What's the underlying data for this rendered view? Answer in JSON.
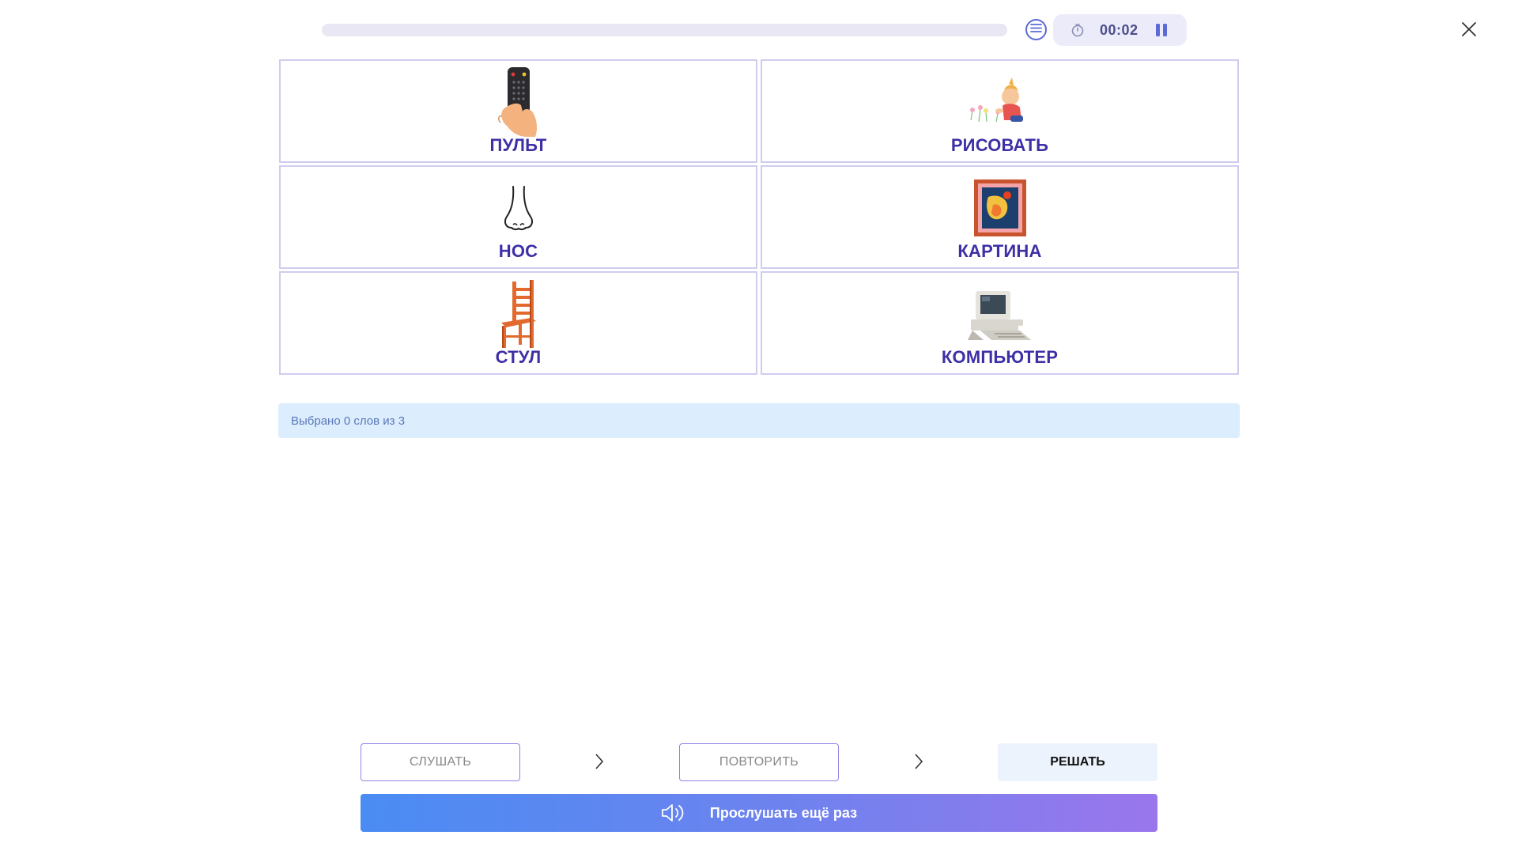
{
  "header": {
    "progress": 0,
    "timer": "00:02",
    "icons": {
      "list": "list-icon",
      "clock": "clock-icon",
      "pause": "pause-icon",
      "close": "close-icon"
    }
  },
  "cards": [
    {
      "word": "ПУЛЬТ",
      "icon": "remote-control-icon"
    },
    {
      "word": "РИСОВАТЬ",
      "icon": "child-drawing-icon"
    },
    {
      "word": "НОС",
      "icon": "nose-icon"
    },
    {
      "word": "КАРТИНА",
      "icon": "framed-picture-icon"
    },
    {
      "word": "СТУЛ",
      "icon": "chair-icon"
    },
    {
      "word": "КОМПЬЮТЕР",
      "icon": "computer-icon"
    }
  ],
  "status": {
    "text": "Выбрано 0 слов из 3"
  },
  "steps": {
    "listen": "СЛУШАТЬ",
    "repeat": "ПОВТОРИТЬ",
    "solve": "РЕШАТЬ"
  },
  "action": {
    "listen_again": "Прослушать ещё раз",
    "icon": "speaker-icon"
  },
  "colors": {
    "word": "#3d2fa6",
    "card_border": "#cfcdee",
    "status_bg": "#dcedfd",
    "gradient_start": "#4a8cf3",
    "gradient_end": "#9a76ec"
  }
}
